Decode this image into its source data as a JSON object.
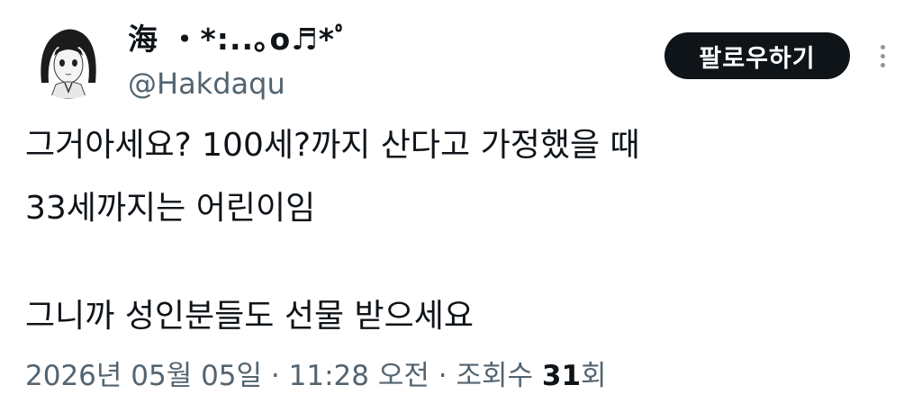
{
  "author": {
    "display_name": "海 ・*:..｡o♬*ﾟ",
    "handle": "@Hakdaqu",
    "avatar_icon": "anime-girl-avatar"
  },
  "follow_label": "팔로우하기",
  "more_icon": "vertical-ellipsis-icon",
  "tweet": {
    "lines": [
      "그거아세요? 100세?까지 산다고 가정했을 때",
      "33세까지는 어린이임",
      "그니까 성인분들도 선물 받으세요"
    ]
  },
  "meta": {
    "date": "2026년 05월 05일",
    "separator": "·",
    "time": "11:28 오전",
    "views_label_prefix": "조회수",
    "views_count": "31",
    "views_label_suffix": "회"
  },
  "colors": {
    "text": "#0f1419",
    "secondary": "#536471",
    "button_bg": "#0f1419",
    "button_text": "#ffffff"
  }
}
